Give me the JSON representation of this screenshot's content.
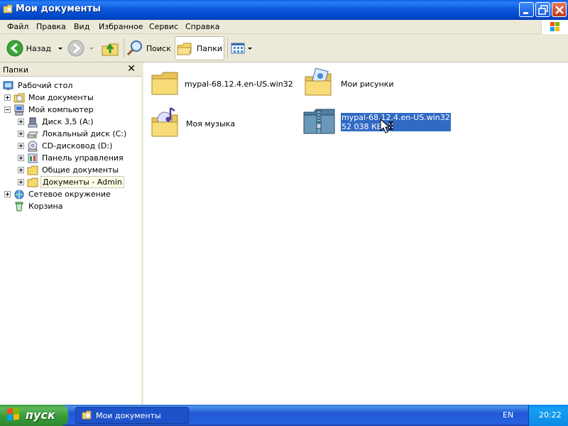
{
  "window": {
    "title": "Мои документы"
  },
  "menu": {
    "items": [
      "Файл",
      "Правка",
      "Вид",
      "Избранное",
      "Сервис",
      "Справка"
    ]
  },
  "toolbar": {
    "back_label": "Назад",
    "search_label": "Поиск",
    "folders_label": "Папки"
  },
  "folders_pane": {
    "title": "Папки",
    "tree": [
      {
        "label": "Рабочий стол",
        "icon": "desktop-icon"
      },
      {
        "label": "Мои документы",
        "icon": "my-documents-icon"
      },
      {
        "label": "Мой компьютер",
        "icon": "my-computer-icon"
      },
      {
        "label": "Диск 3,5 (A:)",
        "icon": "floppy-icon"
      },
      {
        "label": "Локальный диск (C:)",
        "icon": "hard-disk-icon"
      },
      {
        "label": "CD-дисковод (D:)",
        "icon": "cd-drive-icon"
      },
      {
        "label": "Панель управления",
        "icon": "control-panel-icon"
      },
      {
        "label": "Общие документы",
        "icon": "folder-icon"
      },
      {
        "label": "Документы - Admin",
        "icon": "folder-icon"
      },
      {
        "label": "Сетевое окружение",
        "icon": "network-icon"
      },
      {
        "label": "Корзина",
        "icon": "recycle-bin-icon"
      }
    ]
  },
  "content": {
    "items": [
      {
        "name": "mypal-68.12.4.en-US.win32",
        "icon": "folder-icon"
      },
      {
        "name": "Мои рисунки",
        "icon": "pictures-folder-icon"
      },
      {
        "name": "Моя музыка",
        "icon": "music-folder-icon"
      },
      {
        "name": "mypal-68.12.4.en-US.win32",
        "size": "52 038 КБ",
        "icon": "zip-archive-icon"
      }
    ]
  },
  "taskbar": {
    "start_label": "пуск",
    "task_label": "Мои документы",
    "language": "EN",
    "clock": "20:22"
  },
  "colors": {
    "titlebar": "#0a58dc",
    "selection": "#316ac5",
    "start_button": "#379a37",
    "taskbar": "#2157d7"
  }
}
